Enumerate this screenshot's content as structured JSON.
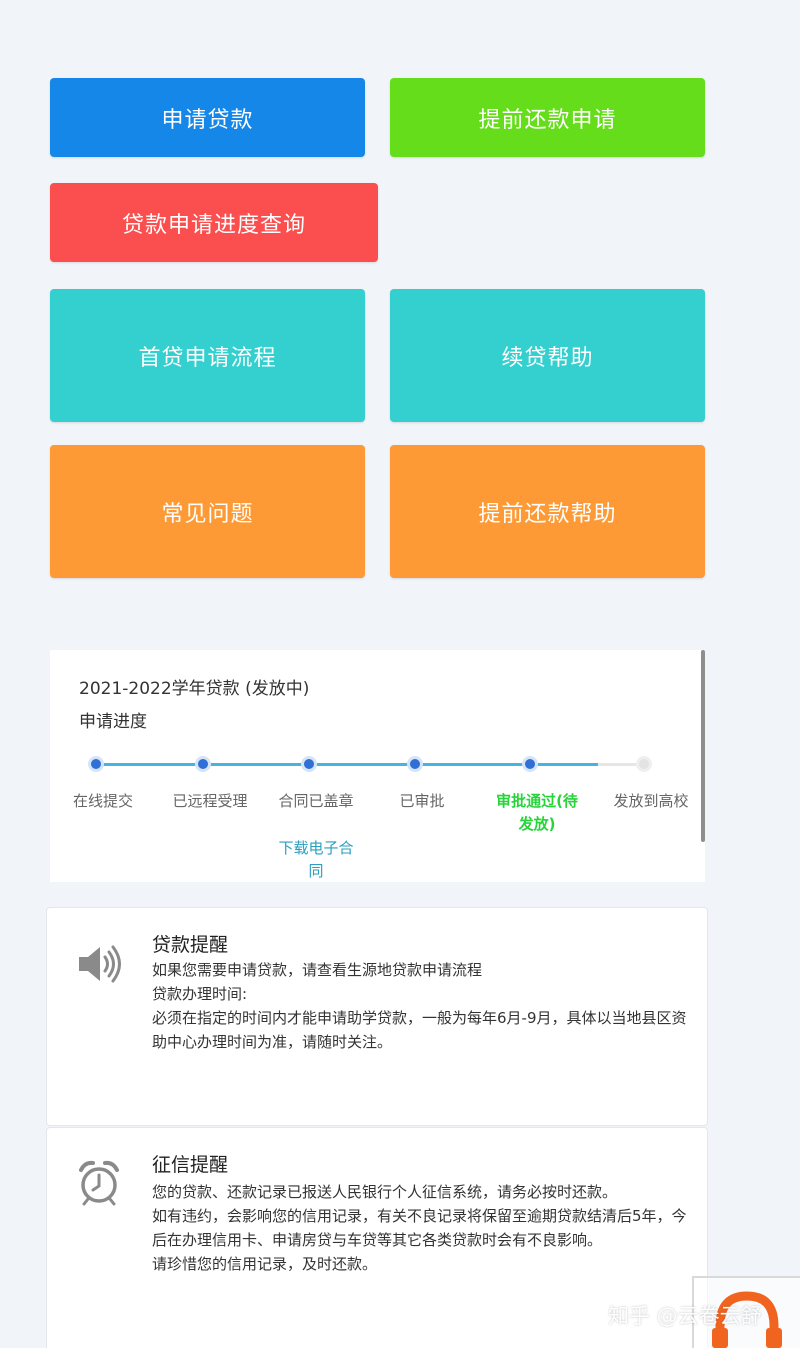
{
  "buttons": {
    "apply_loan": "申请贷款",
    "early_repay_apply": "提前还款申请",
    "progress_query": "贷款申请进度查询",
    "first_loan_flow": "首贷申请流程",
    "renew_help": "续贷帮助",
    "faq": "常见问题",
    "early_repay_help": "提前还款帮助"
  },
  "progress": {
    "year_title": "2021-2022学年贷款 (发放中)",
    "subtitle": "申请进度",
    "steps": [
      {
        "label": "在线提交",
        "status": "done"
      },
      {
        "label": "已远程受理",
        "status": "done"
      },
      {
        "label": "合同已盖章",
        "status": "done"
      },
      {
        "label": "已审批",
        "status": "done"
      },
      {
        "label": "审批通过(待发放)",
        "status": "current"
      },
      {
        "label": "发放到高校",
        "status": "pending"
      }
    ],
    "contract_link": "下载电子合同"
  },
  "notices": {
    "loan_reminder": {
      "icon": "speaker-icon",
      "title": "贷款提醒",
      "line1": "如果您需要申请贷款，请查看生源地贷款申请流程",
      "line2": "贷款办理时间:",
      "line3": "必须在指定的时间内才能申请助学贷款，一般为每年6月-9月，具体以当地县区资助中心办理时间为准，请随时关注。"
    },
    "credit_reminder": {
      "icon": "alarm-clock-icon",
      "title": "征信提醒",
      "line1": "您的贷款、还款记录已报送人民银行个人征信系统，请务必按时还款。",
      "line2": "如有违约，会影响您的信用记录，有关不良记录将保留至逾期贷款结清后5年，今后在办理信用卡、申请房贷与车贷等其它各类贷款时会有不良影响。",
      "line3": "请珍惜您的信用记录，及时还款。"
    }
  },
  "watermark": "知乎 @云卷云舒",
  "colors": {
    "blue": "#1587e8",
    "green": "#65dd1a",
    "red": "#fb4e4e",
    "teal": "#34cfcf",
    "orange": "#fd9a35",
    "progress_line": "#45b4e0",
    "current_step": "#27d43a"
  }
}
